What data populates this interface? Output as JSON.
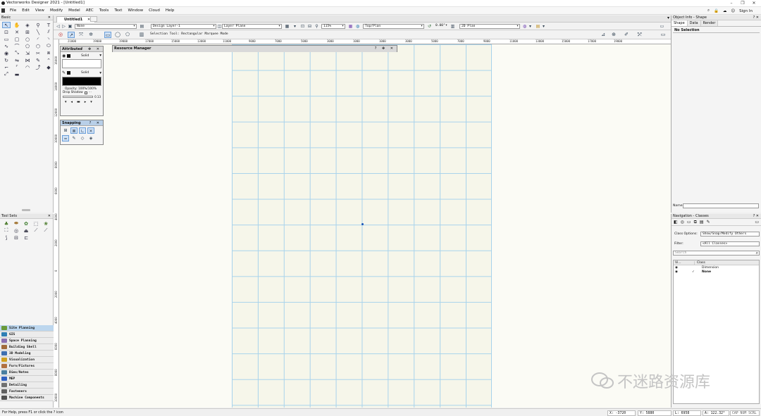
{
  "window": {
    "title": "Vectorworks Designer 2021 - [Untitled1]",
    "min": "–",
    "max": "❐",
    "close": "✕"
  },
  "menubar": {
    "items": [
      "File",
      "Edit",
      "View",
      "Modify",
      "Model",
      "AEC",
      "Tools",
      "Text",
      "Window",
      "Cloud",
      "Help"
    ],
    "sign_in": "Sign In"
  },
  "palettes": {
    "basic_title": "Basic",
    "toolsets_title": "Tool Sets",
    "toolsets": [
      {
        "label": "Site Planning",
        "color": "#6a9a3a",
        "active": true
      },
      {
        "label": "GIS",
        "color": "#2f7fb5"
      },
      {
        "label": "Space Planning",
        "color": "#8a6fb0"
      },
      {
        "label": "Building Shell",
        "color": "#a06a3a"
      },
      {
        "label": "3D Modeling",
        "color": "#3f6fb0"
      },
      {
        "label": "Visualization",
        "color": "#d0a020"
      },
      {
        "label": "Furn/Fixtures",
        "color": "#b07040"
      },
      {
        "label": "Dims/Notes",
        "color": "#4a7fa0"
      },
      {
        "label": "MEP",
        "color": "#3060c0"
      },
      {
        "label": "Detailing",
        "color": "#707070"
      },
      {
        "label": "Fasteners",
        "color": "#606060"
      },
      {
        "label": "Machine Components",
        "color": "#505050"
      }
    ]
  },
  "document": {
    "tab": "Untitled1"
  },
  "viewbar": {
    "class": "None",
    "design_layer": "Design Layer-1",
    "plane": "Layer Plane",
    "zoom": "115%",
    "view": "Top/Plan",
    "rotation": "0.00°",
    "render": "2D Plan"
  },
  "modebar": {
    "text": "Selection Tool: Rectangular Marquee Mode"
  },
  "rulers": {
    "h": [
      "21000",
      "19000",
      "19000",
      "17000",
      "15000",
      "13000",
      "11000",
      "9000",
      "7000",
      "5000",
      "3000",
      "1000",
      "1000",
      "3000",
      "5000",
      "7000",
      "9000",
      "11000",
      "13000",
      "15000",
      "17000",
      "19000"
    ],
    "v": [
      "16000",
      "14000",
      "12000",
      "10000",
      "8000",
      "6000",
      "4000",
      "2000",
      "0",
      "2000",
      "4000",
      "6000",
      "8000",
      "10000",
      "12000",
      "14000",
      "16000"
    ]
  },
  "attributes": {
    "title": "Attributes",
    "fill_style": "Solid",
    "pen_style": "Solid",
    "opacity": "Opacity: 100%/100%",
    "drop_shadow": "Drop Shadow",
    "line_weight": "0.13"
  },
  "snapping": {
    "title": "Snapping"
  },
  "resource_manager": {
    "title": "Resource Manager"
  },
  "object_info": {
    "title": "Object Info - Shape",
    "tabs": [
      "Shape",
      "Data",
      "Render"
    ],
    "selection": "No Selection",
    "name_label": "Name:"
  },
  "navigation": {
    "title": "Navigation - Classes",
    "class_options_label": "Class Options:",
    "class_options_value": "Show/Snap/Modify Others",
    "filter_label": "Filter:",
    "filter_value": "<All Classes>",
    "search_placeholder": "Search",
    "col_vis": "Vi...",
    "col_class": "Class",
    "rows": [
      {
        "name": "Dimension",
        "active": false
      },
      {
        "name": "None",
        "active": true
      }
    ]
  },
  "status": {
    "help": "For Help, press F1 or click the ? icon",
    "x": "X: -3720",
    "y": "Y: 5880",
    "l": "L: 6958",
    "a": "A: 122.32°",
    "flags": "CAP NUM SCRL"
  },
  "watermark": {
    "text": "不迷路资源库"
  }
}
